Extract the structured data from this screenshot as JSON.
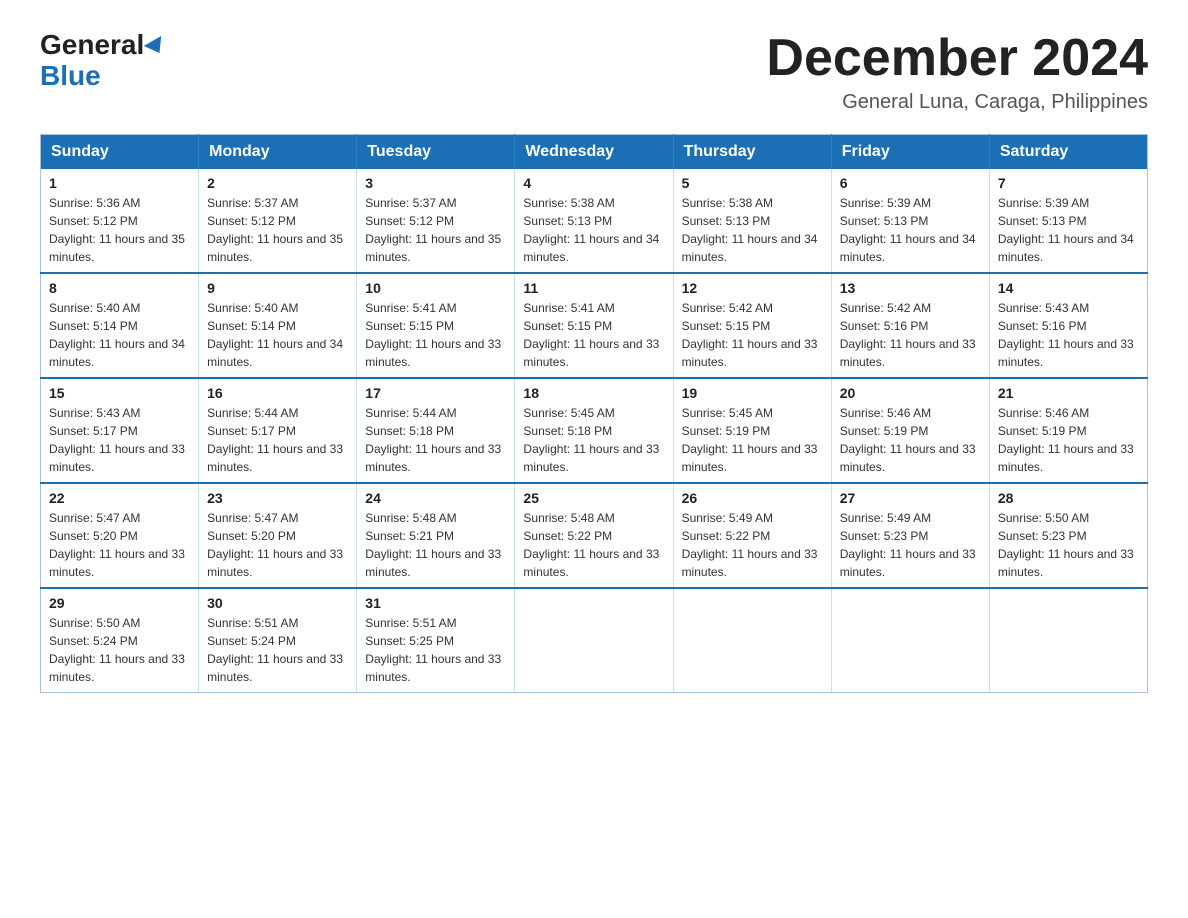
{
  "logo": {
    "general": "General",
    "blue": "Blue"
  },
  "title": "December 2024",
  "subtitle": "General Luna, Caraga, Philippines",
  "days_of_week": [
    "Sunday",
    "Monday",
    "Tuesday",
    "Wednesday",
    "Thursday",
    "Friday",
    "Saturday"
  ],
  "weeks": [
    [
      {
        "day": "1",
        "sunrise": "5:36 AM",
        "sunset": "5:12 PM",
        "daylight": "11 hours and 35 minutes."
      },
      {
        "day": "2",
        "sunrise": "5:37 AM",
        "sunset": "5:12 PM",
        "daylight": "11 hours and 35 minutes."
      },
      {
        "day": "3",
        "sunrise": "5:37 AM",
        "sunset": "5:12 PM",
        "daylight": "11 hours and 35 minutes."
      },
      {
        "day": "4",
        "sunrise": "5:38 AM",
        "sunset": "5:13 PM",
        "daylight": "11 hours and 34 minutes."
      },
      {
        "day": "5",
        "sunrise": "5:38 AM",
        "sunset": "5:13 PM",
        "daylight": "11 hours and 34 minutes."
      },
      {
        "day": "6",
        "sunrise": "5:39 AM",
        "sunset": "5:13 PM",
        "daylight": "11 hours and 34 minutes."
      },
      {
        "day": "7",
        "sunrise": "5:39 AM",
        "sunset": "5:13 PM",
        "daylight": "11 hours and 34 minutes."
      }
    ],
    [
      {
        "day": "8",
        "sunrise": "5:40 AM",
        "sunset": "5:14 PM",
        "daylight": "11 hours and 34 minutes."
      },
      {
        "day": "9",
        "sunrise": "5:40 AM",
        "sunset": "5:14 PM",
        "daylight": "11 hours and 34 minutes."
      },
      {
        "day": "10",
        "sunrise": "5:41 AM",
        "sunset": "5:15 PM",
        "daylight": "11 hours and 33 minutes."
      },
      {
        "day": "11",
        "sunrise": "5:41 AM",
        "sunset": "5:15 PM",
        "daylight": "11 hours and 33 minutes."
      },
      {
        "day": "12",
        "sunrise": "5:42 AM",
        "sunset": "5:15 PM",
        "daylight": "11 hours and 33 minutes."
      },
      {
        "day": "13",
        "sunrise": "5:42 AM",
        "sunset": "5:16 PM",
        "daylight": "11 hours and 33 minutes."
      },
      {
        "day": "14",
        "sunrise": "5:43 AM",
        "sunset": "5:16 PM",
        "daylight": "11 hours and 33 minutes."
      }
    ],
    [
      {
        "day": "15",
        "sunrise": "5:43 AM",
        "sunset": "5:17 PM",
        "daylight": "11 hours and 33 minutes."
      },
      {
        "day": "16",
        "sunrise": "5:44 AM",
        "sunset": "5:17 PM",
        "daylight": "11 hours and 33 minutes."
      },
      {
        "day": "17",
        "sunrise": "5:44 AM",
        "sunset": "5:18 PM",
        "daylight": "11 hours and 33 minutes."
      },
      {
        "day": "18",
        "sunrise": "5:45 AM",
        "sunset": "5:18 PM",
        "daylight": "11 hours and 33 minutes."
      },
      {
        "day": "19",
        "sunrise": "5:45 AM",
        "sunset": "5:19 PM",
        "daylight": "11 hours and 33 minutes."
      },
      {
        "day": "20",
        "sunrise": "5:46 AM",
        "sunset": "5:19 PM",
        "daylight": "11 hours and 33 minutes."
      },
      {
        "day": "21",
        "sunrise": "5:46 AM",
        "sunset": "5:19 PM",
        "daylight": "11 hours and 33 minutes."
      }
    ],
    [
      {
        "day": "22",
        "sunrise": "5:47 AM",
        "sunset": "5:20 PM",
        "daylight": "11 hours and 33 minutes."
      },
      {
        "day": "23",
        "sunrise": "5:47 AM",
        "sunset": "5:20 PM",
        "daylight": "11 hours and 33 minutes."
      },
      {
        "day": "24",
        "sunrise": "5:48 AM",
        "sunset": "5:21 PM",
        "daylight": "11 hours and 33 minutes."
      },
      {
        "day": "25",
        "sunrise": "5:48 AM",
        "sunset": "5:22 PM",
        "daylight": "11 hours and 33 minutes."
      },
      {
        "day": "26",
        "sunrise": "5:49 AM",
        "sunset": "5:22 PM",
        "daylight": "11 hours and 33 minutes."
      },
      {
        "day": "27",
        "sunrise": "5:49 AM",
        "sunset": "5:23 PM",
        "daylight": "11 hours and 33 minutes."
      },
      {
        "day": "28",
        "sunrise": "5:50 AM",
        "sunset": "5:23 PM",
        "daylight": "11 hours and 33 minutes."
      }
    ],
    [
      {
        "day": "29",
        "sunrise": "5:50 AM",
        "sunset": "5:24 PM",
        "daylight": "11 hours and 33 minutes."
      },
      {
        "day": "30",
        "sunrise": "5:51 AM",
        "sunset": "5:24 PM",
        "daylight": "11 hours and 33 minutes."
      },
      {
        "day": "31",
        "sunrise": "5:51 AM",
        "sunset": "5:25 PM",
        "daylight": "11 hours and 33 minutes."
      },
      null,
      null,
      null,
      null
    ]
  ],
  "labels": {
    "sunrise": "Sunrise:",
    "sunset": "Sunset:",
    "daylight": "Daylight:"
  }
}
